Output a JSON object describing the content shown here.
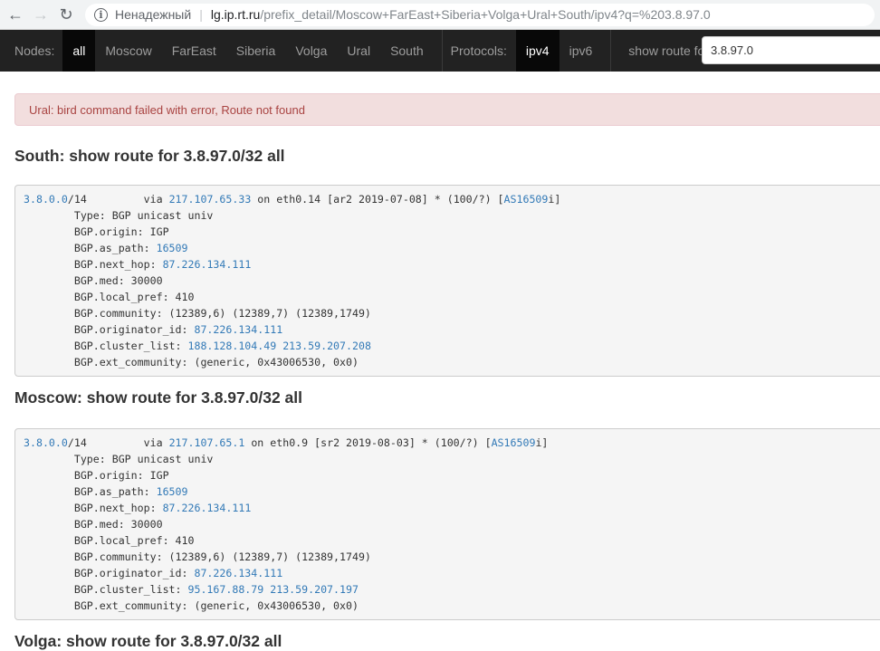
{
  "browser": {
    "insecure_label": "Ненадежный",
    "url_host": "lg.ip.rt.ru",
    "url_path": "/prefix_detail/Moscow+FarEast+Siberia+Volga+Ural+South/ipv4?q=%203.8.97.0",
    "back_icon": "←",
    "forward_icon": "→",
    "reload_icon": "↻"
  },
  "navbar": {
    "nodes_label": "Nodes:",
    "nodes": [
      "all",
      "Moscow",
      "FarEast",
      "Siberia",
      "Volga",
      "Ural",
      "South"
    ],
    "protocols_label": "Protocols:",
    "protocols": [
      "ipv4",
      "ipv6"
    ],
    "command_label": "show route for",
    "search_value": "3.8.97.0"
  },
  "alert": "Ural: bird command failed with error, Route not found",
  "sections": [
    {
      "title": "South: show route for 3.8.97.0/32 all",
      "prefix": "3.8.0.0",
      "prefix_len": "/14",
      "via_ip": "217.107.65.33",
      "route_suffix": " on eth0.14 [ar2 2019-07-08] * (100/?) [",
      "as_link": "AS16509",
      "as_suffix": "i]",
      "type": "Type: BGP unicast univ",
      "origin": "BGP.origin: IGP",
      "as_path_label": "BGP.as_path: ",
      "as_path": "16509",
      "next_hop_label": "BGP.next_hop: ",
      "next_hop": "87.226.134.111",
      "med": "BGP.med: 30000",
      "local_pref": "BGP.local_pref: 410",
      "community": "BGP.community: (12389,6) (12389,7) (12389,1749)",
      "originator_label": "BGP.originator_id: ",
      "originator": "87.226.134.111",
      "cluster_label": "BGP.cluster_list: ",
      "cluster1": "188.128.104.49",
      "cluster2": "213.59.207.208",
      "ext_community": "BGP.ext_community: (generic, 0x43006530, 0x0)"
    },
    {
      "title": "Moscow: show route for 3.8.97.0/32 all",
      "prefix": "3.8.0.0",
      "prefix_len": "/14",
      "via_ip": "217.107.65.1",
      "route_suffix": " on eth0.9 [sr2 2019-08-03] * (100/?) [",
      "as_link": "AS16509",
      "as_suffix": "i]",
      "type": "Type: BGP unicast univ",
      "origin": "BGP.origin: IGP",
      "as_path_label": "BGP.as_path: ",
      "as_path": "16509",
      "next_hop_label": "BGP.next_hop: ",
      "next_hop": "87.226.134.111",
      "med": "BGP.med: 30000",
      "local_pref": "BGP.local_pref: 410",
      "community": "BGP.community: (12389,6) (12389,7) (12389,1749)",
      "originator_label": "BGP.originator_id: ",
      "originator": "87.226.134.111",
      "cluster_label": "BGP.cluster_list: ",
      "cluster1": "95.167.88.79",
      "cluster2": "213.59.207.197",
      "ext_community": "BGP.ext_community: (generic, 0x43006530, 0x0)"
    }
  ],
  "next_title": "Volga: show route for 3.8.97.0/32 all"
}
